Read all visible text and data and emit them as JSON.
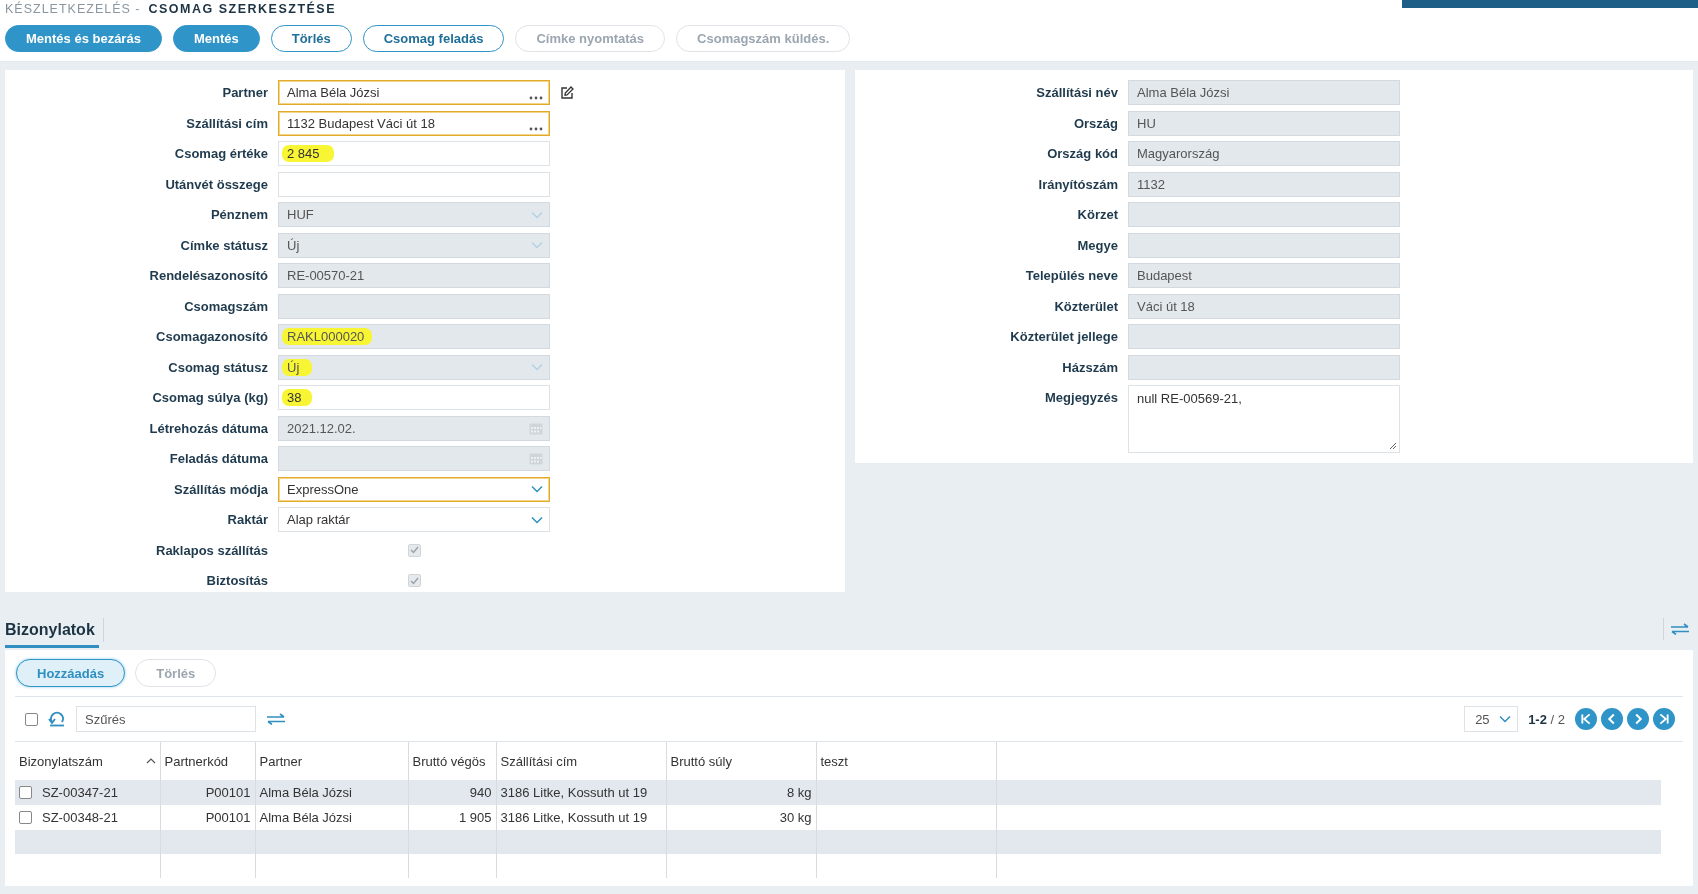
{
  "breadcrumb": {
    "section": "KÉSZLETKEZELÉS -",
    "page": "CSOMAG SZERKESZTÉSE"
  },
  "toolbar": [
    {
      "label": "Mentés és bezárás",
      "kind": "primary",
      "disabled": false
    },
    {
      "label": "Mentés",
      "kind": "primary",
      "disabled": false
    },
    {
      "label": "Törlés",
      "kind": "outline",
      "disabled": false
    },
    {
      "label": "Csomag feladás",
      "kind": "outline",
      "disabled": false
    },
    {
      "label": "Címke nyomtatás",
      "kind": "outline",
      "disabled": true
    },
    {
      "label": "Csomagszám küldés.",
      "kind": "outline",
      "disabled": true
    }
  ],
  "left_form": [
    {
      "label": "Partner",
      "kind": "lookup",
      "value": "Alma Béla Józsi",
      "disabled": false,
      "required": true,
      "edit_button": true
    },
    {
      "label": "Szállítási cím",
      "kind": "lookup",
      "value": "1132 Budapest Váci út 18",
      "disabled": false,
      "required": true
    },
    {
      "label": "Csomag értéke",
      "kind": "text",
      "value": "2 845",
      "disabled": false,
      "required": false,
      "highlighted": true
    },
    {
      "label": "Utánvét összege",
      "kind": "text",
      "disabled": false,
      "required": false
    },
    {
      "label": "Pénznem",
      "kind": "select",
      "value": "HUF",
      "disabled": true,
      "required": false
    },
    {
      "label": "Címke státusz",
      "kind": "select",
      "value": "Új",
      "disabled": true,
      "required": false
    },
    {
      "label": "Rendelésazonosító",
      "kind": "text",
      "value": "RE-00570-21",
      "disabled": true,
      "required": false
    },
    {
      "label": "Csomagszám",
      "kind": "text",
      "disabled": true,
      "required": false
    },
    {
      "label": "Csomagazonosító",
      "kind": "text",
      "value": "RAKL000020",
      "disabled": true,
      "required": false,
      "highlighted": true
    },
    {
      "label": "Csomag státusz",
      "kind": "select",
      "value": "Új",
      "disabled": true,
      "required": false,
      "highlighted": true
    },
    {
      "label": "Csomag súlya (kg)",
      "kind": "text",
      "value": "38",
      "disabled": false,
      "required": false,
      "highlighted": true
    },
    {
      "label": "Létrehozás dátuma",
      "kind": "date",
      "value": "2021.12.02.",
      "disabled": true,
      "required": false
    },
    {
      "label": "Feladás dátuma",
      "kind": "date",
      "disabled": true,
      "required": false
    },
    {
      "label": "Szállítás módja",
      "kind": "select",
      "value": "ExpressOne",
      "disabled": false,
      "required": true
    },
    {
      "label": "Raktár",
      "kind": "select",
      "value": "Alap raktár",
      "disabled": false,
      "required": false
    },
    {
      "label": "Raklapos szállítás",
      "kind": "checkbox",
      "checked": true,
      "disabled": true
    },
    {
      "label": "Biztosítás",
      "kind": "checkbox",
      "checked": true,
      "disabled": true
    }
  ],
  "right_form": [
    {
      "label": "Szállítási név",
      "kind": "text",
      "value": "Alma Béla Józsi",
      "disabled": true,
      "required": false
    },
    {
      "label": "Ország",
      "kind": "text",
      "value": "HU",
      "disabled": true,
      "required": false
    },
    {
      "label": "Ország kód",
      "kind": "text",
      "value": "Magyarország",
      "disabled": true,
      "required": false
    },
    {
      "label": "Irányítószám",
      "kind": "text",
      "value": "1132",
      "disabled": true,
      "required": false
    },
    {
      "label": "Körzet",
      "kind": "text",
      "disabled": true,
      "required": false
    },
    {
      "label": "Megye",
      "kind": "text",
      "disabled": true,
      "required": false
    },
    {
      "label": "Település neve",
      "kind": "text",
      "value": "Budapest",
      "disabled": true,
      "required": false
    },
    {
      "label": "Közterület",
      "kind": "text",
      "value": "Váci út 18",
      "disabled": true,
      "required": false
    },
    {
      "label": "Közterület jellege",
      "kind": "text",
      "disabled": true,
      "required": false
    },
    {
      "label": "Házszám",
      "kind": "text",
      "disabled": true,
      "required": false
    },
    {
      "label": "Megjegyzés",
      "kind": "textarea",
      "value": "null RE-00569-21,",
      "disabled": false,
      "required": false
    }
  ],
  "documents": {
    "tabs": [
      {
        "label": "Bizonylatok",
        "selected": true
      }
    ],
    "buttons": [
      {
        "label": "Hozzáadás",
        "disabled": false
      },
      {
        "label": "Törlés",
        "disabled": true
      }
    ],
    "select_all": {
      "checked": false
    },
    "filter": {
      "placeholder": "Szűrés"
    },
    "page_size": "25",
    "range": "**1-2** / 2",
    "columns": [
      {
        "label": "Bizonylatszám",
        "kind": "text",
        "sorted": true
      },
      {
        "label": "Partnerkód",
        "kind": "number"
      },
      {
        "label": "Partner",
        "kind": "text"
      },
      {
        "label": "Bruttó végös",
        "kind": "number"
      },
      {
        "label": "Szállítási cím",
        "kind": "text"
      },
      {
        "label": "Bruttó súly",
        "kind": "number"
      },
      {
        "label": "teszt",
        "kind": "text"
      }
    ],
    "rows": [
      {
        "checked": false,
        "cells": [
          "SZ-00347-21",
          "P00101",
          "Alma Béla Józsi",
          "940",
          "3186 Litke, Kossuth ut 19",
          "8 kg",
          ""
        ]
      },
      {
        "checked": false,
        "cells": [
          "SZ-00348-21",
          "P00101",
          "Alma Béla Józsi",
          "1 905",
          "3186 Litke, Kossuth ut 19",
          "30 kg",
          ""
        ]
      }
    ]
  }
}
